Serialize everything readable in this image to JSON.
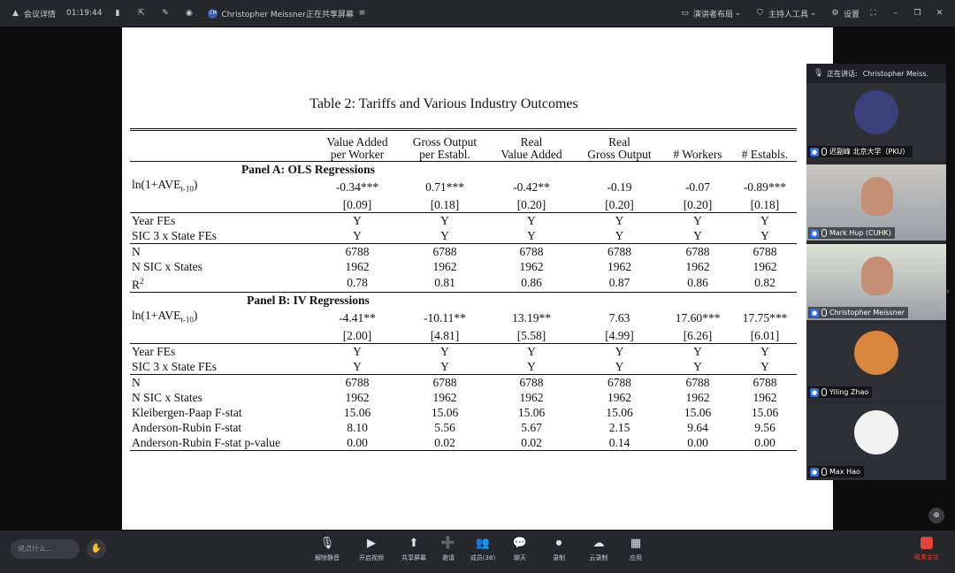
{
  "topbar": {
    "meeting_label": "会议详情",
    "elapsed": "01:19:44",
    "sharer": "Christopher Meissner正在共享屏幕",
    "sharer_avatar": "CM",
    "layout_label": "演讲者布局",
    "host_label": "主持人工具",
    "settings_label": "设置"
  },
  "slide": {
    "title": "Table 2:  Tariffs and Various Industry Outcomes",
    "headers": [
      [
        "Value Added",
        "per Worker"
      ],
      [
        "Gross Output",
        "per Establ."
      ],
      [
        "Real",
        "Value Added"
      ],
      [
        "Real",
        "Gross Output"
      ],
      [
        "",
        "# Workers"
      ],
      [
        "",
        "# Establs."
      ]
    ],
    "panel_a": {
      "title": "Panel A: OLS Regressions",
      "coef_label": "ln(1+AVE",
      "coef_sub": "t-10",
      "coef_close": ")",
      "coefs": [
        "-0.34***",
        "0.71***",
        "-0.42**",
        "-0.19",
        "-0.07",
        "-0.89***"
      ],
      "ses": [
        "[0.09]",
        "[0.18]",
        "[0.20]",
        "[0.20]",
        "[0.20]",
        "[0.18]"
      ],
      "rows": [
        {
          "label": "Year FEs",
          "values": [
            "Y",
            "Y",
            "Y",
            "Y",
            "Y",
            "Y"
          ]
        },
        {
          "label": "SIC 3 x State FEs",
          "values": [
            "Y",
            "Y",
            "Y",
            "Y",
            "Y",
            "Y"
          ]
        },
        {
          "label": "N",
          "values": [
            "6788",
            "6788",
            "6788",
            "6788",
            "6788",
            "6788"
          ]
        },
        {
          "label": "N SIC x States",
          "values": [
            "1962",
            "1962",
            "1962",
            "1962",
            "1962",
            "1962"
          ]
        }
      ],
      "r2_label": "R",
      "r2_sup": "2",
      "r2_values": [
        "0.78",
        "0.81",
        "0.86",
        "0.87",
        "0.86",
        "0.82"
      ]
    },
    "panel_b": {
      "title": "Panel B: IV Regressions",
      "coef_label": "ln(1+AVE",
      "coef_sub": "t-10",
      "coef_close": ")",
      "coefs": [
        "-4.41**",
        "-10.11**",
        "13.19**",
        "7.63",
        "17.60***",
        "17.75***"
      ],
      "ses": [
        "[2.00]",
        "[4.81]",
        "[5.58]",
        "[4.99]",
        "[6.26]",
        "[6.01]"
      ],
      "rows": [
        {
          "label": "Year FEs",
          "values": [
            "Y",
            "Y",
            "Y",
            "Y",
            "Y",
            "Y"
          ]
        },
        {
          "label": "SIC 3 x State FEs",
          "values": [
            "Y",
            "Y",
            "Y",
            "Y",
            "Y",
            "Y"
          ]
        },
        {
          "label": "N",
          "values": [
            "6788",
            "6788",
            "6788",
            "6788",
            "6788",
            "6788"
          ]
        },
        {
          "label": "N SIC x States",
          "values": [
            "1962",
            "1962",
            "1962",
            "1962",
            "1962",
            "1962"
          ]
        },
        {
          "label": "Kleibergen-Paap F-stat",
          "values": [
            "15.06",
            "15.06",
            "15.06",
            "15.06",
            "15.06",
            "15.06"
          ]
        },
        {
          "label": "Anderson-Rubin F-stat",
          "values": [
            "8.10",
            "5.56",
            "5.67",
            "2.15",
            "9.64",
            "9.56"
          ]
        },
        {
          "label": "Anderson-Rubin F-stat p-value",
          "values": [
            "0.00",
            "0.02",
            "0.02",
            "0.14",
            "0.00",
            "0.00"
          ]
        }
      ]
    }
  },
  "participants": {
    "speaking_label": "正在讲话:",
    "speaking_name": "Christopher Meiss.",
    "list": [
      {
        "name": "迟副峰 北京大学（PKU）",
        "kind": "avatar",
        "color": "#3b3f7a"
      },
      {
        "name": "Mark Hup (CUHK)",
        "kind": "camera",
        "color": "#c9c7c2"
      },
      {
        "name": "Christopher Meissner",
        "kind": "camera",
        "color": "#dfe3d6",
        "active": true
      },
      {
        "name": "Yiling Zhao",
        "kind": "avatar",
        "color": "#d9873e"
      },
      {
        "name": "Max Hao",
        "kind": "avatar",
        "color": "#f2f2f2"
      }
    ]
  },
  "bottombar": {
    "chat_placeholder": "说点什么...",
    "controls": [
      "解除静音",
      "开启视频",
      "共享屏幕",
      "邀请",
      "成员(38)",
      "聊天",
      "录制",
      "云录制",
      "应用"
    ],
    "leave": "结束会议"
  },
  "colors": {
    "active": "#2ec46d",
    "leave": "#e0443a",
    "accent": "#2f6fe0"
  }
}
